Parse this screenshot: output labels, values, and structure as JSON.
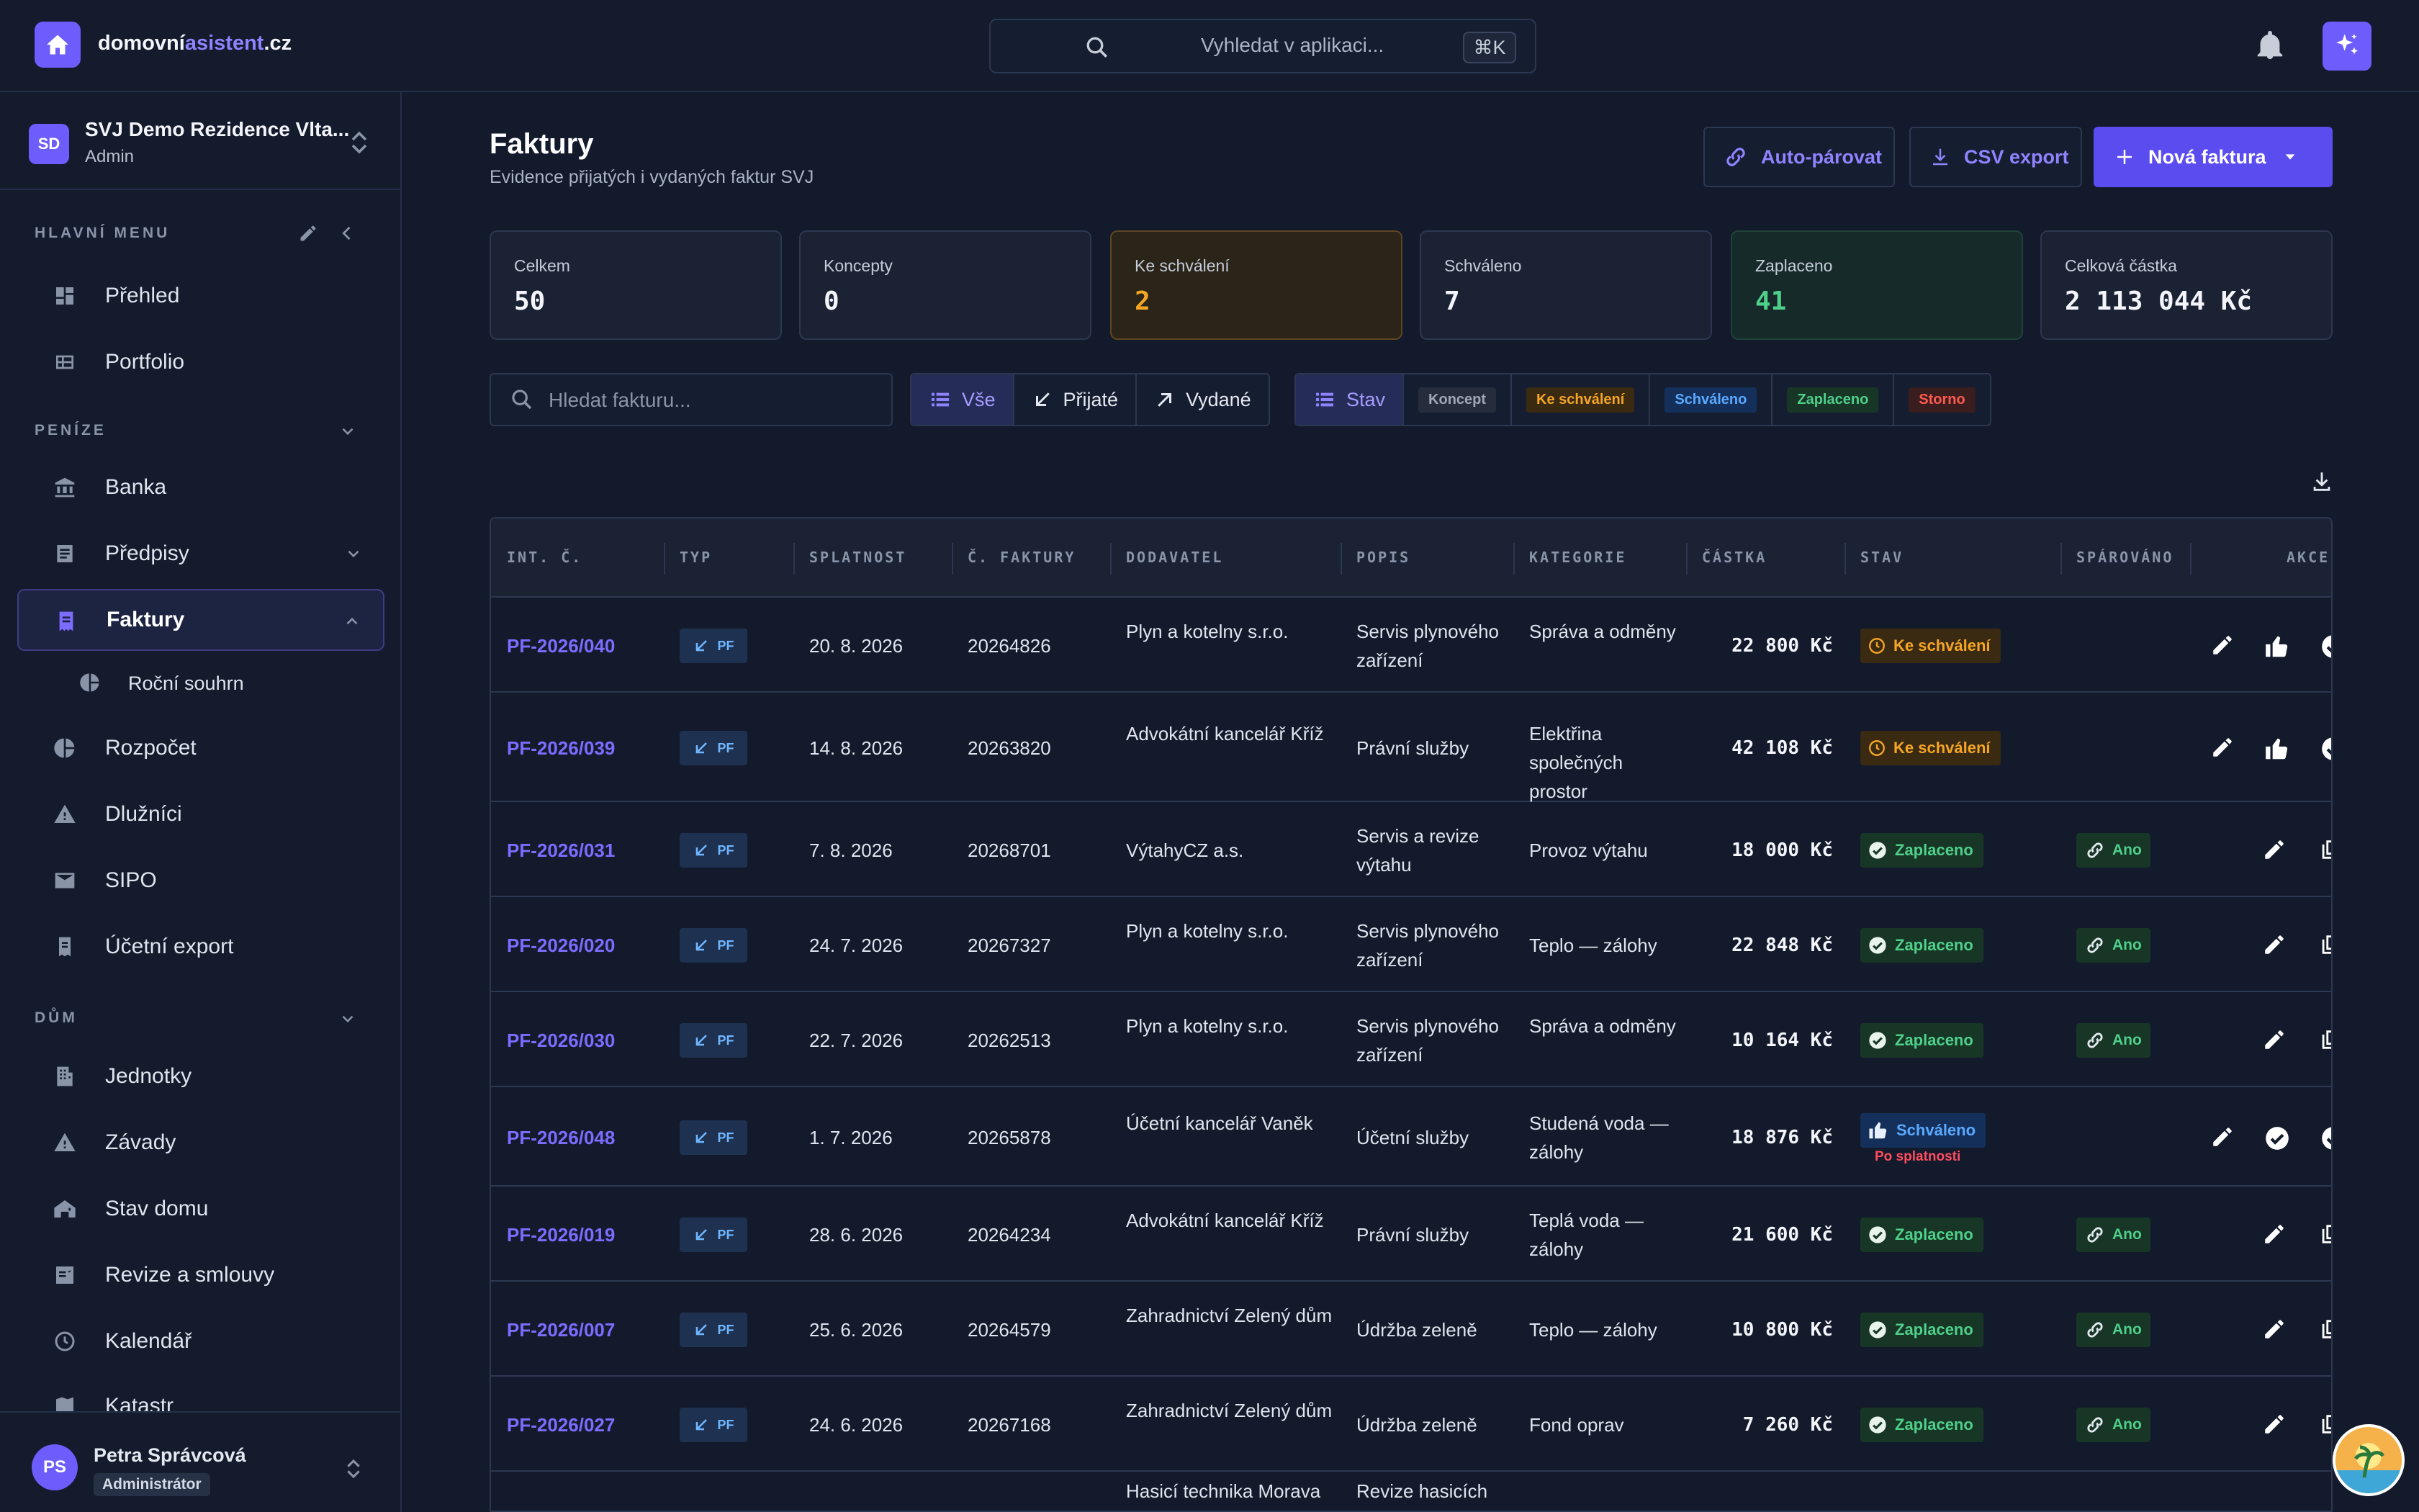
{
  "brand": {
    "name_part1": "domovní",
    "name_part2": "asistent",
    "name_part3": ".cz"
  },
  "global_search": {
    "placeholder": "Vyhledat v aplikaci...",
    "shortcut": "⌘K"
  },
  "org": {
    "initials": "SD",
    "name": "SVJ Demo Rezidence Vlta...",
    "role": "Admin"
  },
  "sidebar": {
    "section_main": "HLAVNÍ MENU",
    "section_money": "PENÍZE",
    "section_house": "DŮM",
    "items": {
      "prehled": "Přehled",
      "portfolio": "Portfolio",
      "banka": "Banka",
      "predpisy": "Předpisy",
      "faktury": "Faktury",
      "rocni": "Roční souhrn",
      "rozpocet": "Rozpočet",
      "dluznici": "Dlužníci",
      "sipo": "SIPO",
      "ucetni": "Účetní export",
      "jednotky": "Jednotky",
      "zavady": "Závady",
      "stav": "Stav domu",
      "revize": "Revize a smlouvy",
      "kalendar": "Kalendář",
      "katastr": "Katastr"
    }
  },
  "user": {
    "initials": "PS",
    "name": "Petra Správcová",
    "role": "Administrátor"
  },
  "page": {
    "title": "Faktury",
    "subtitle": "Evidence přijatých i vydaných faktur SVJ"
  },
  "buttons": {
    "autopair": "Auto-párovat",
    "csv": "CSV export",
    "new": "Nová faktura"
  },
  "stats": [
    {
      "label": "Celkem",
      "value": "50"
    },
    {
      "label": "Koncepty",
      "value": "0"
    },
    {
      "label": "Ke schválení",
      "value": "2"
    },
    {
      "label": "Schváleno",
      "value": "7"
    },
    {
      "label": "Zaplaceno",
      "value": "41"
    },
    {
      "label": "Celková částka",
      "value": "2 113 044 Kč"
    }
  ],
  "filter": {
    "search_placeholder": "Hledat fakturu...",
    "all": "Vše",
    "received": "Přijaté",
    "issued": "Vydané",
    "state": "Stav",
    "s_draft": "Koncept",
    "s_pending": "Ke schválení",
    "s_approved": "Schváleno",
    "s_paid": "Zaplaceno",
    "s_storno": "Storno"
  },
  "colors": {
    "accent": "#6d5dfc",
    "pending": "#f5a524",
    "paid": "#4fd08a",
    "approved": "#5aa9ff",
    "storno": "#ff5a4e"
  },
  "table": {
    "headers": {
      "int": "INT. Č.",
      "typ": "TYP",
      "due": "SPLATNOST",
      "no": "Č. FAKTURY",
      "vendor": "DODAVATEL",
      "desc": "POPIS",
      "cat": "KATEGORIE",
      "amt": "ČÁSTKA",
      "state": "STAV",
      "paired": "SPÁROVÁNO",
      "act": "AKCE"
    },
    "type_label": "PF",
    "paired_label": "Ano",
    "overdue_label": "Po splatnosti",
    "rows": [
      {
        "id": "PF-2026/040",
        "due": "20. 8. 2026",
        "no": "20264826",
        "vendor": "Plyn a kotelny s.r.o.",
        "desc": "Servis plynového zařízení",
        "cat": "Správa a odměny",
        "amt": "22 800 Kč",
        "state": "Ke schválení"
      },
      {
        "id": "PF-2026/039",
        "due": "14. 8. 2026",
        "no": "20263820",
        "vendor": "Advokátní kancelář Kříž",
        "desc": "Právní služby",
        "cat": "Elektřina společných prostor",
        "amt": "42 108 Kč",
        "state": "Ke schválení"
      },
      {
        "id": "PF-2026/031",
        "due": "7. 8. 2026",
        "no": "20268701",
        "vendor": "VýtahyCZ a.s.",
        "desc": "Servis a revize výtahu",
        "cat": "Provoz výtahu",
        "amt": "18 000 Kč",
        "state": "Zaplaceno"
      },
      {
        "id": "PF-2026/020",
        "due": "24. 7. 2026",
        "no": "20267327",
        "vendor": "Plyn a kotelny s.r.o.",
        "desc": "Servis plynového zařízení",
        "cat": "Teplo — zálohy",
        "amt": "22 848 Kč",
        "state": "Zaplaceno"
      },
      {
        "id": "PF-2026/030",
        "due": "22. 7. 2026",
        "no": "20262513",
        "vendor": "Plyn a kotelny s.r.o.",
        "desc": "Servis plynového zařízení",
        "cat": "Správa a odměny",
        "amt": "10 164 Kč",
        "state": "Zaplaceno"
      },
      {
        "id": "PF-2026/048",
        "due": "1. 7. 2026",
        "no": "20265878",
        "vendor": "Účetní kancelář Vaněk",
        "desc": "Účetní služby",
        "cat": "Studená voda — zálohy",
        "amt": "18 876 Kč",
        "state": "Schváleno"
      },
      {
        "id": "PF-2026/019",
        "due": "28. 6. 2026",
        "no": "20264234",
        "vendor": "Advokátní kancelář Kříž",
        "desc": "Právní služby",
        "cat": "Teplá voda — zálohy",
        "amt": "21 600 Kč",
        "state": "Zaplaceno"
      },
      {
        "id": "PF-2026/007",
        "due": "25. 6. 2026",
        "no": "20264579",
        "vendor": "Zahradnictví Zelený dům",
        "desc": "Údržba zeleně",
        "cat": "Teplo — zálohy",
        "amt": "10 800 Kč",
        "state": "Zaplaceno"
      },
      {
        "id": "PF-2026/027",
        "due": "24. 6. 2026",
        "no": "20267168",
        "vendor": "Zahradnictví Zelený dům",
        "desc": "Údržba zeleně",
        "cat": "Fond oprav",
        "amt": "7 260 Kč",
        "state": "Zaplaceno"
      },
      {
        "id": "",
        "due": "",
        "no": "",
        "vendor": "Hasicí technika Morava",
        "desc": "Revize hasicích",
        "cat": "",
        "amt": "",
        "state": ""
      }
    ]
  }
}
